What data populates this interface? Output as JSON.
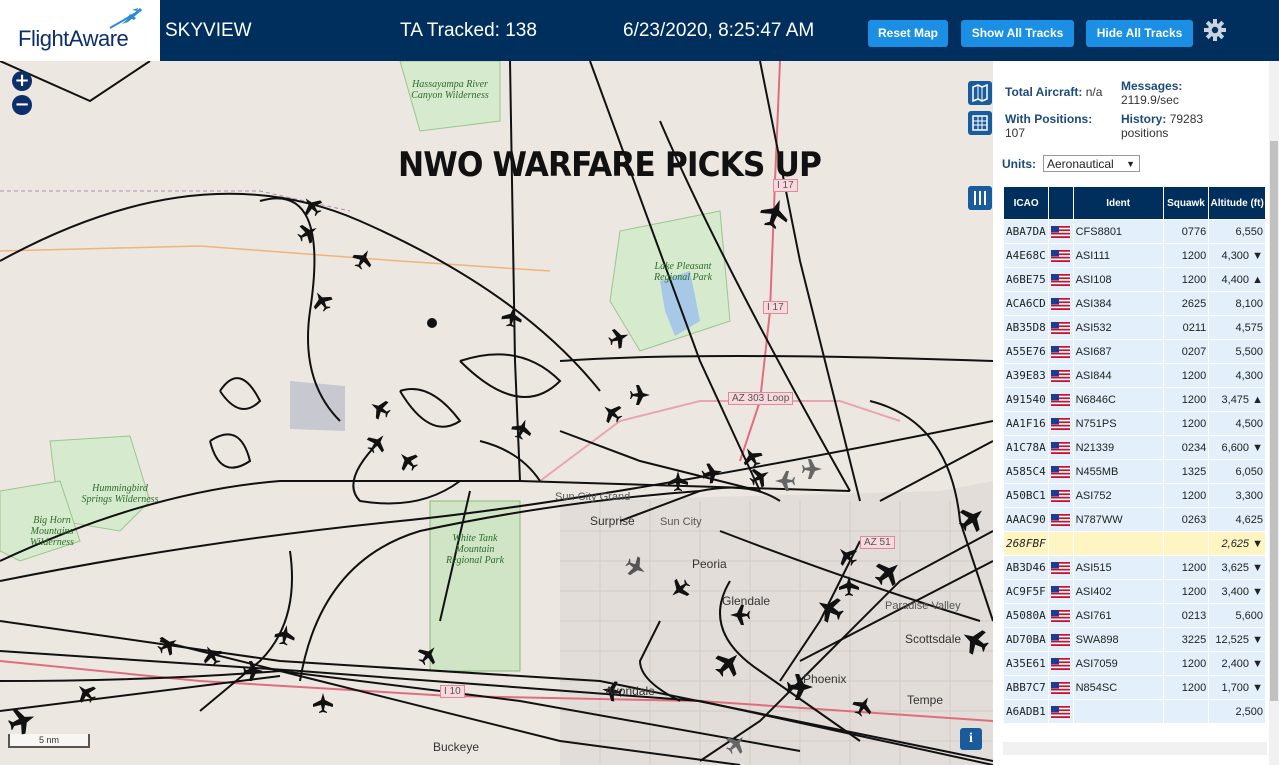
{
  "header": {
    "logo_text": "FlightAware",
    "app_title": "SKYVIEW",
    "tracked": "TA Tracked: 138",
    "timestamp": "6/23/2020, 8:25:47 AM",
    "buttons": {
      "reset": "Reset Map",
      "show_all": "Show All Tracks",
      "hide_all": "Hide All Tracks"
    }
  },
  "map": {
    "headline": "NWO WARFARE PICKS UP",
    "zoom_in": "+",
    "zoom_out": "−",
    "scale": "5 nm",
    "info": "i",
    "parks": [
      "Hassayampa River Canyon Wilderness",
      "Lake Pleasant Regional Park",
      "Hummingbird Springs Wilderness",
      "Big Horn Mountains Wilderness",
      "White Tank Mountain Regional Park"
    ],
    "cities": [
      "Sun City Grand",
      "Surprise",
      "Sun City",
      "Peoria",
      "Glendale",
      "Paradise Valley",
      "Scottsdale",
      "Phoenix",
      "Avondale",
      "Tempe",
      "Buckeye"
    ],
    "shields": [
      "I 17",
      "I 17",
      "AZ 303 Loop",
      "I 10",
      "AZ 51"
    ]
  },
  "sidebar": {
    "total_aircraft_label": "Total Aircraft:",
    "total_aircraft_value": "n/a",
    "messages_label": "Messages:",
    "messages_value": "2119.9/sec",
    "with_positions_label": "With Positions:",
    "with_positions_value": "107",
    "history_label": "History:",
    "history_value": "79283",
    "history_unit": "positions",
    "units_label": "Units:",
    "units_value": "Aeronautical",
    "columns": [
      "ICAO",
      "",
      "Ident",
      "Squawk",
      "Altitude (ft)"
    ],
    "rows": [
      {
        "icao": "ABA7DA",
        "ident": "CFS8801",
        "squawk": "0776",
        "alt": "6,550",
        "trend": ""
      },
      {
        "icao": "A4E68C",
        "ident": "ASI111",
        "squawk": "1200",
        "alt": "4,300",
        "trend": "▼"
      },
      {
        "icao": "A6BE75",
        "ident": "ASI108",
        "squawk": "1200",
        "alt": "4,400",
        "trend": "▲"
      },
      {
        "icao": "ACA6CD",
        "ident": "ASI384",
        "squawk": "2625",
        "alt": "8,100",
        "trend": ""
      },
      {
        "icao": "AB35D8",
        "ident": "ASI532",
        "squawk": "0211",
        "alt": "4,575",
        "trend": ""
      },
      {
        "icao": "A55E76",
        "ident": "ASI687",
        "squawk": "0207",
        "alt": "5,500",
        "trend": ""
      },
      {
        "icao": "A39E83",
        "ident": "ASI844",
        "squawk": "1200",
        "alt": "4,300",
        "trend": ""
      },
      {
        "icao": "A91540",
        "ident": "N6846C",
        "squawk": "1200",
        "alt": "3,475",
        "trend": "▲"
      },
      {
        "icao": "AA1F16",
        "ident": "N751PS",
        "squawk": "1200",
        "alt": "4,500",
        "trend": ""
      },
      {
        "icao": "A1C78A",
        "ident": "N21339",
        "squawk": "0234",
        "alt": "6,600",
        "trend": "▼"
      },
      {
        "icao": "A585C4",
        "ident": "N455MB",
        "squawk": "1325",
        "alt": "6,050",
        "trend": ""
      },
      {
        "icao": "A50BC1",
        "ident": "ASI752",
        "squawk": "1200",
        "alt": "3,300",
        "trend": ""
      },
      {
        "icao": "AAAC90",
        "ident": "N787WW",
        "squawk": "0263",
        "alt": "4,625",
        "trend": ""
      },
      {
        "icao": "268FBF",
        "ident": "",
        "squawk": "",
        "alt": "2,625",
        "trend": "▼",
        "highlight": true
      },
      {
        "icao": "AB3D46",
        "ident": "ASI515",
        "squawk": "1200",
        "alt": "3,625",
        "trend": "▼"
      },
      {
        "icao": "AC9F5F",
        "ident": "ASI402",
        "squawk": "1200",
        "alt": "3,400",
        "trend": "▼"
      },
      {
        "icao": "A5080A",
        "ident": "ASI761",
        "squawk": "0213",
        "alt": "5,600",
        "trend": ""
      },
      {
        "icao": "AD70BA",
        "ident": "SWA898",
        "squawk": "3225",
        "alt": "12,525",
        "trend": "▼"
      },
      {
        "icao": "A35E61",
        "ident": "ASI7059",
        "squawk": "1200",
        "alt": "2,400",
        "trend": "▼"
      },
      {
        "icao": "ABB7C7",
        "ident": "N854SC",
        "squawk": "1200",
        "alt": "1,700",
        "trend": "▼"
      },
      {
        "icao": "A6ADB1",
        "ident": "",
        "squawk": "",
        "alt": "2,500",
        "trend": ""
      }
    ]
  },
  "colors": {
    "header_bg": "#002f5d",
    "button": "#1a8fe3",
    "row_bg": "#e3f0fb",
    "row_highlight": "#fff5c2"
  }
}
